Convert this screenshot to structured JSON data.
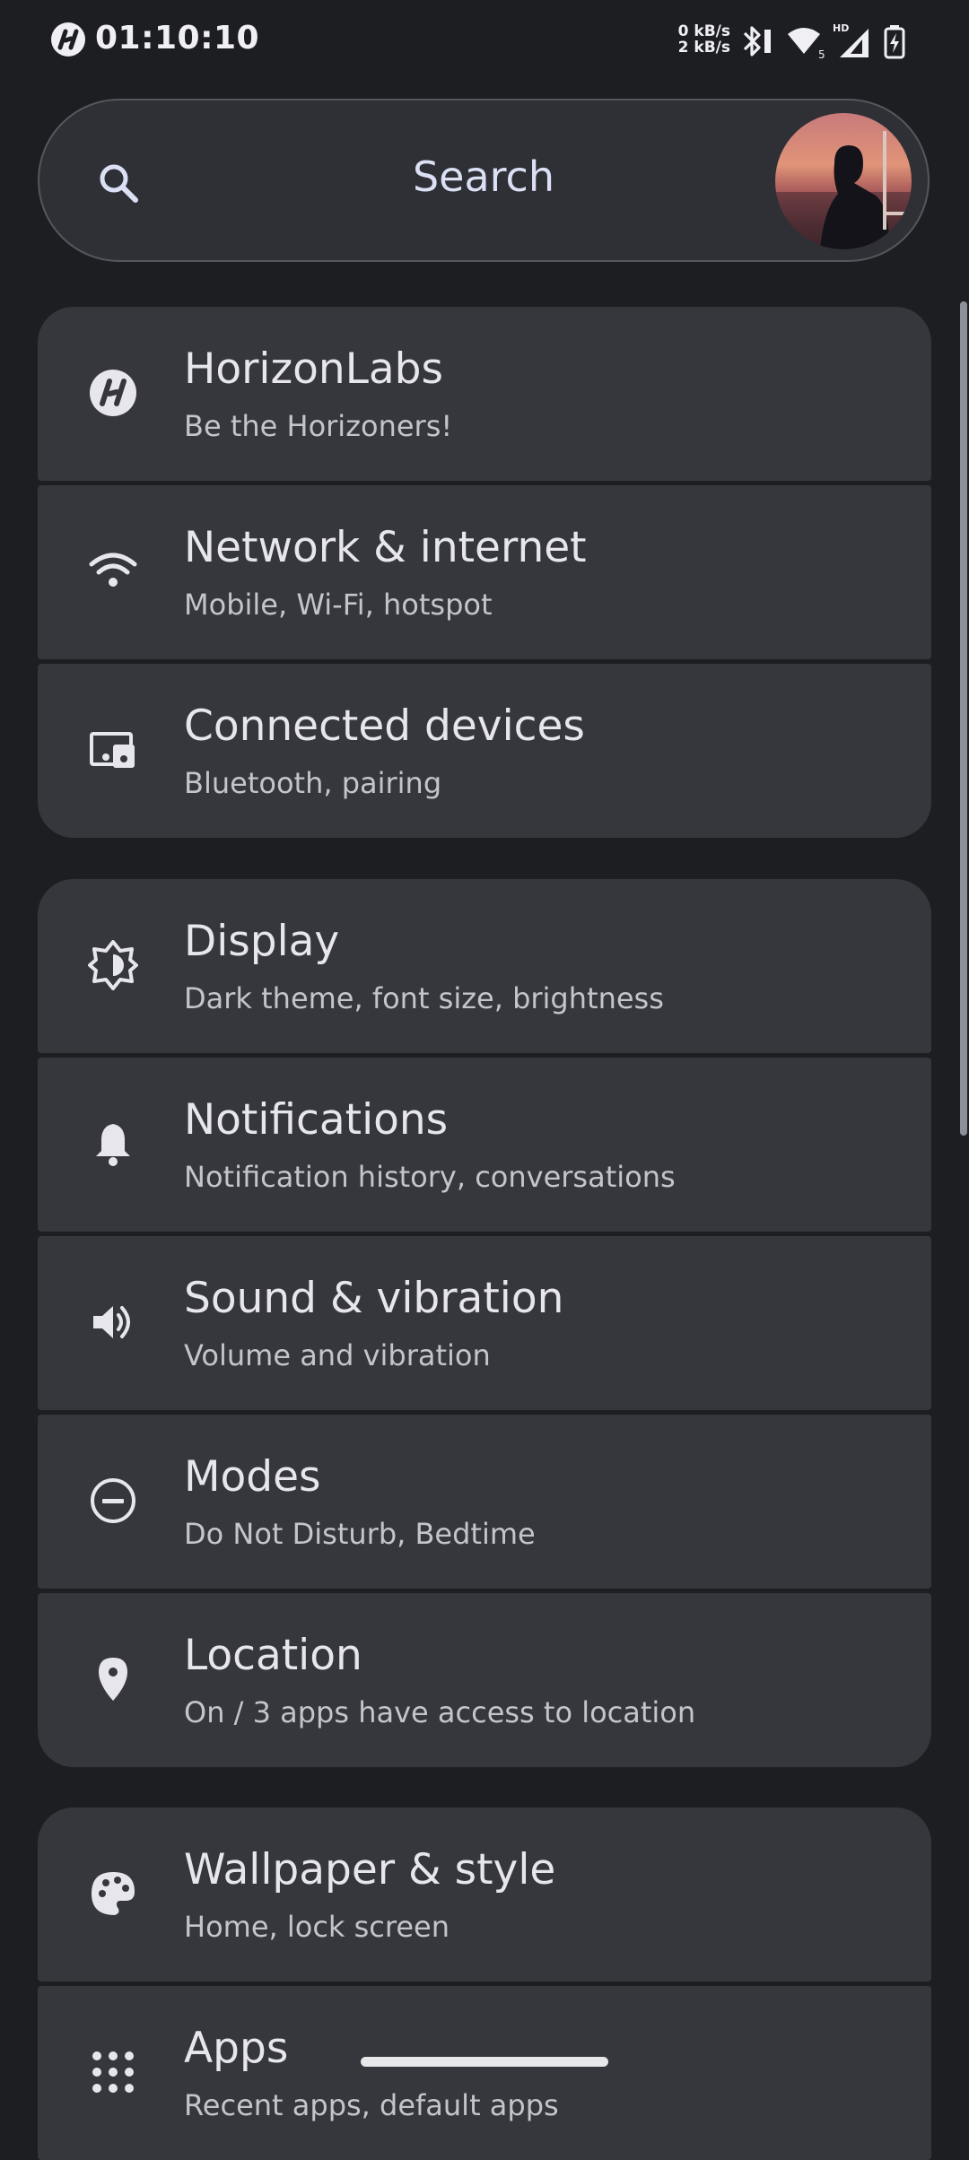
{
  "status_bar": {
    "time": "01:10:10",
    "speed_up": "0 kB/s",
    "speed_down": "2 kB/s",
    "icons": [
      "horizonlabs-logo-icon",
      "bluetooth-icon",
      "wifi-icon",
      "signal-icon",
      "battery-charging-icon"
    ]
  },
  "search": {
    "placeholder": "Search",
    "icon": "search-icon",
    "avatar": "user-avatar"
  },
  "groups": [
    {
      "items": [
        {
          "title": "HorizonLabs",
          "subtitle": "Be the Horizoners!",
          "icon": "horizonlabs-logo-icon"
        },
        {
          "title": "Network & internet",
          "subtitle": "Mobile, Wi-Fi, hotspot",
          "icon": "wifi-icon"
        },
        {
          "title": "Connected devices",
          "subtitle": "Bluetooth, pairing",
          "icon": "devices-icon"
        }
      ]
    },
    {
      "items": [
        {
          "title": "Display",
          "subtitle": "Dark theme, font size, brightness",
          "icon": "brightness-icon"
        },
        {
          "title": "Notifications",
          "subtitle": "Notification history, conversations",
          "icon": "bell-icon"
        },
        {
          "title": "Sound & vibration",
          "subtitle": "Volume and vibration",
          "icon": "volume-icon"
        },
        {
          "title": "Modes",
          "subtitle": "Do Not Disturb, Bedtime",
          "icon": "do-not-disturb-icon"
        },
        {
          "title": "Location",
          "subtitle": "On / 3 apps have access to location",
          "icon": "location-pin-icon"
        }
      ]
    },
    {
      "items": [
        {
          "title": "Wallpaper & style",
          "subtitle": "Home, lock screen",
          "icon": "palette-icon"
        },
        {
          "title": "Apps",
          "subtitle": "Recent apps, default apps",
          "icon": "apps-grid-icon"
        }
      ]
    }
  ],
  "colors": {
    "background": "#1d1e22",
    "card": "#36373d",
    "search_bg": "#2f3036",
    "text_primary": "#e6e6ec",
    "text_secondary": "#c3c4cc",
    "search_text": "#dbe0f5"
  }
}
